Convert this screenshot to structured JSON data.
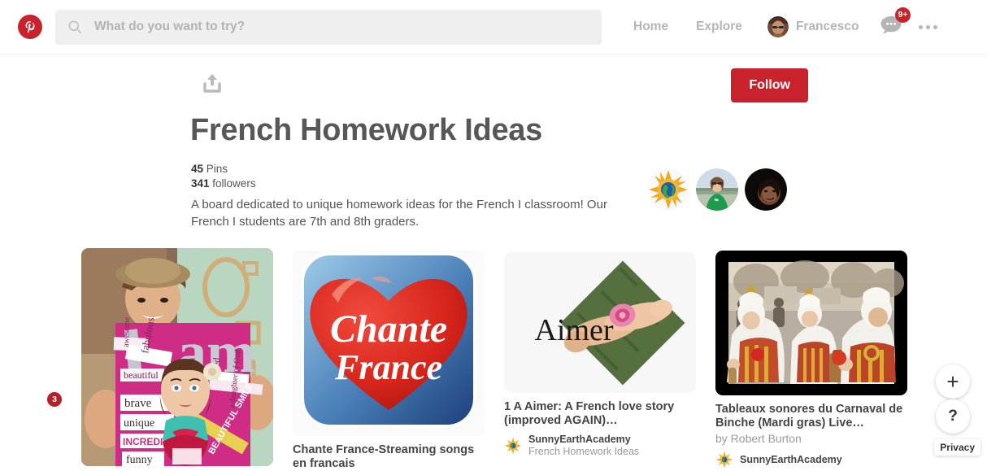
{
  "header": {
    "logo_alt": "Pinterest",
    "search": {
      "value": "",
      "placeholder": "What do you want to try?"
    },
    "nav": [
      {
        "label": "Home"
      },
      {
        "label": "Explore"
      }
    ],
    "user": {
      "name": "Francesco"
    },
    "messages_badge": "9+",
    "accent_red": "#c8232c"
  },
  "board": {
    "title": "French Homework Ideas",
    "follow_label": "Follow",
    "pins_count": "45",
    "pins_label": "Pins",
    "followers_count": "341",
    "followers_label": "followers",
    "description": "A board dedicated to unique homework ideas for the French I classroom! Our French I students are 7th and 8th graders."
  },
  "pins": [
    {
      "title": "",
      "by": "",
      "attr_name": "",
      "attr_board": "",
      "image_alt": "student-holding-i-am-collage-poster"
    },
    {
      "title": "Chante France-Streaming songs en francais",
      "by": "",
      "attr_name": "",
      "attr_board": "",
      "image_alt": "chante-france-heart-logo"
    },
    {
      "title": "1 A Aimer: A French love story (improved AGAIN)…",
      "by": "",
      "attr_name": "SunnyEarthAcademy",
      "attr_board": "French Homework Ideas",
      "image_alt": "aimer-feet-on-grass-diamond"
    },
    {
      "title": "Tableaux sonores du Carnaval de Binche (Mardi gras) Live…",
      "by": "by Robert Burton",
      "attr_name": "SunnyEarthAcademy",
      "attr_board": "",
      "image_alt": "carnaval-de-binche-gilles-costumes"
    }
  ],
  "floating": {
    "add_label": "+",
    "help_label": "?",
    "privacy_label": "Privacy",
    "side_badge": "3"
  }
}
